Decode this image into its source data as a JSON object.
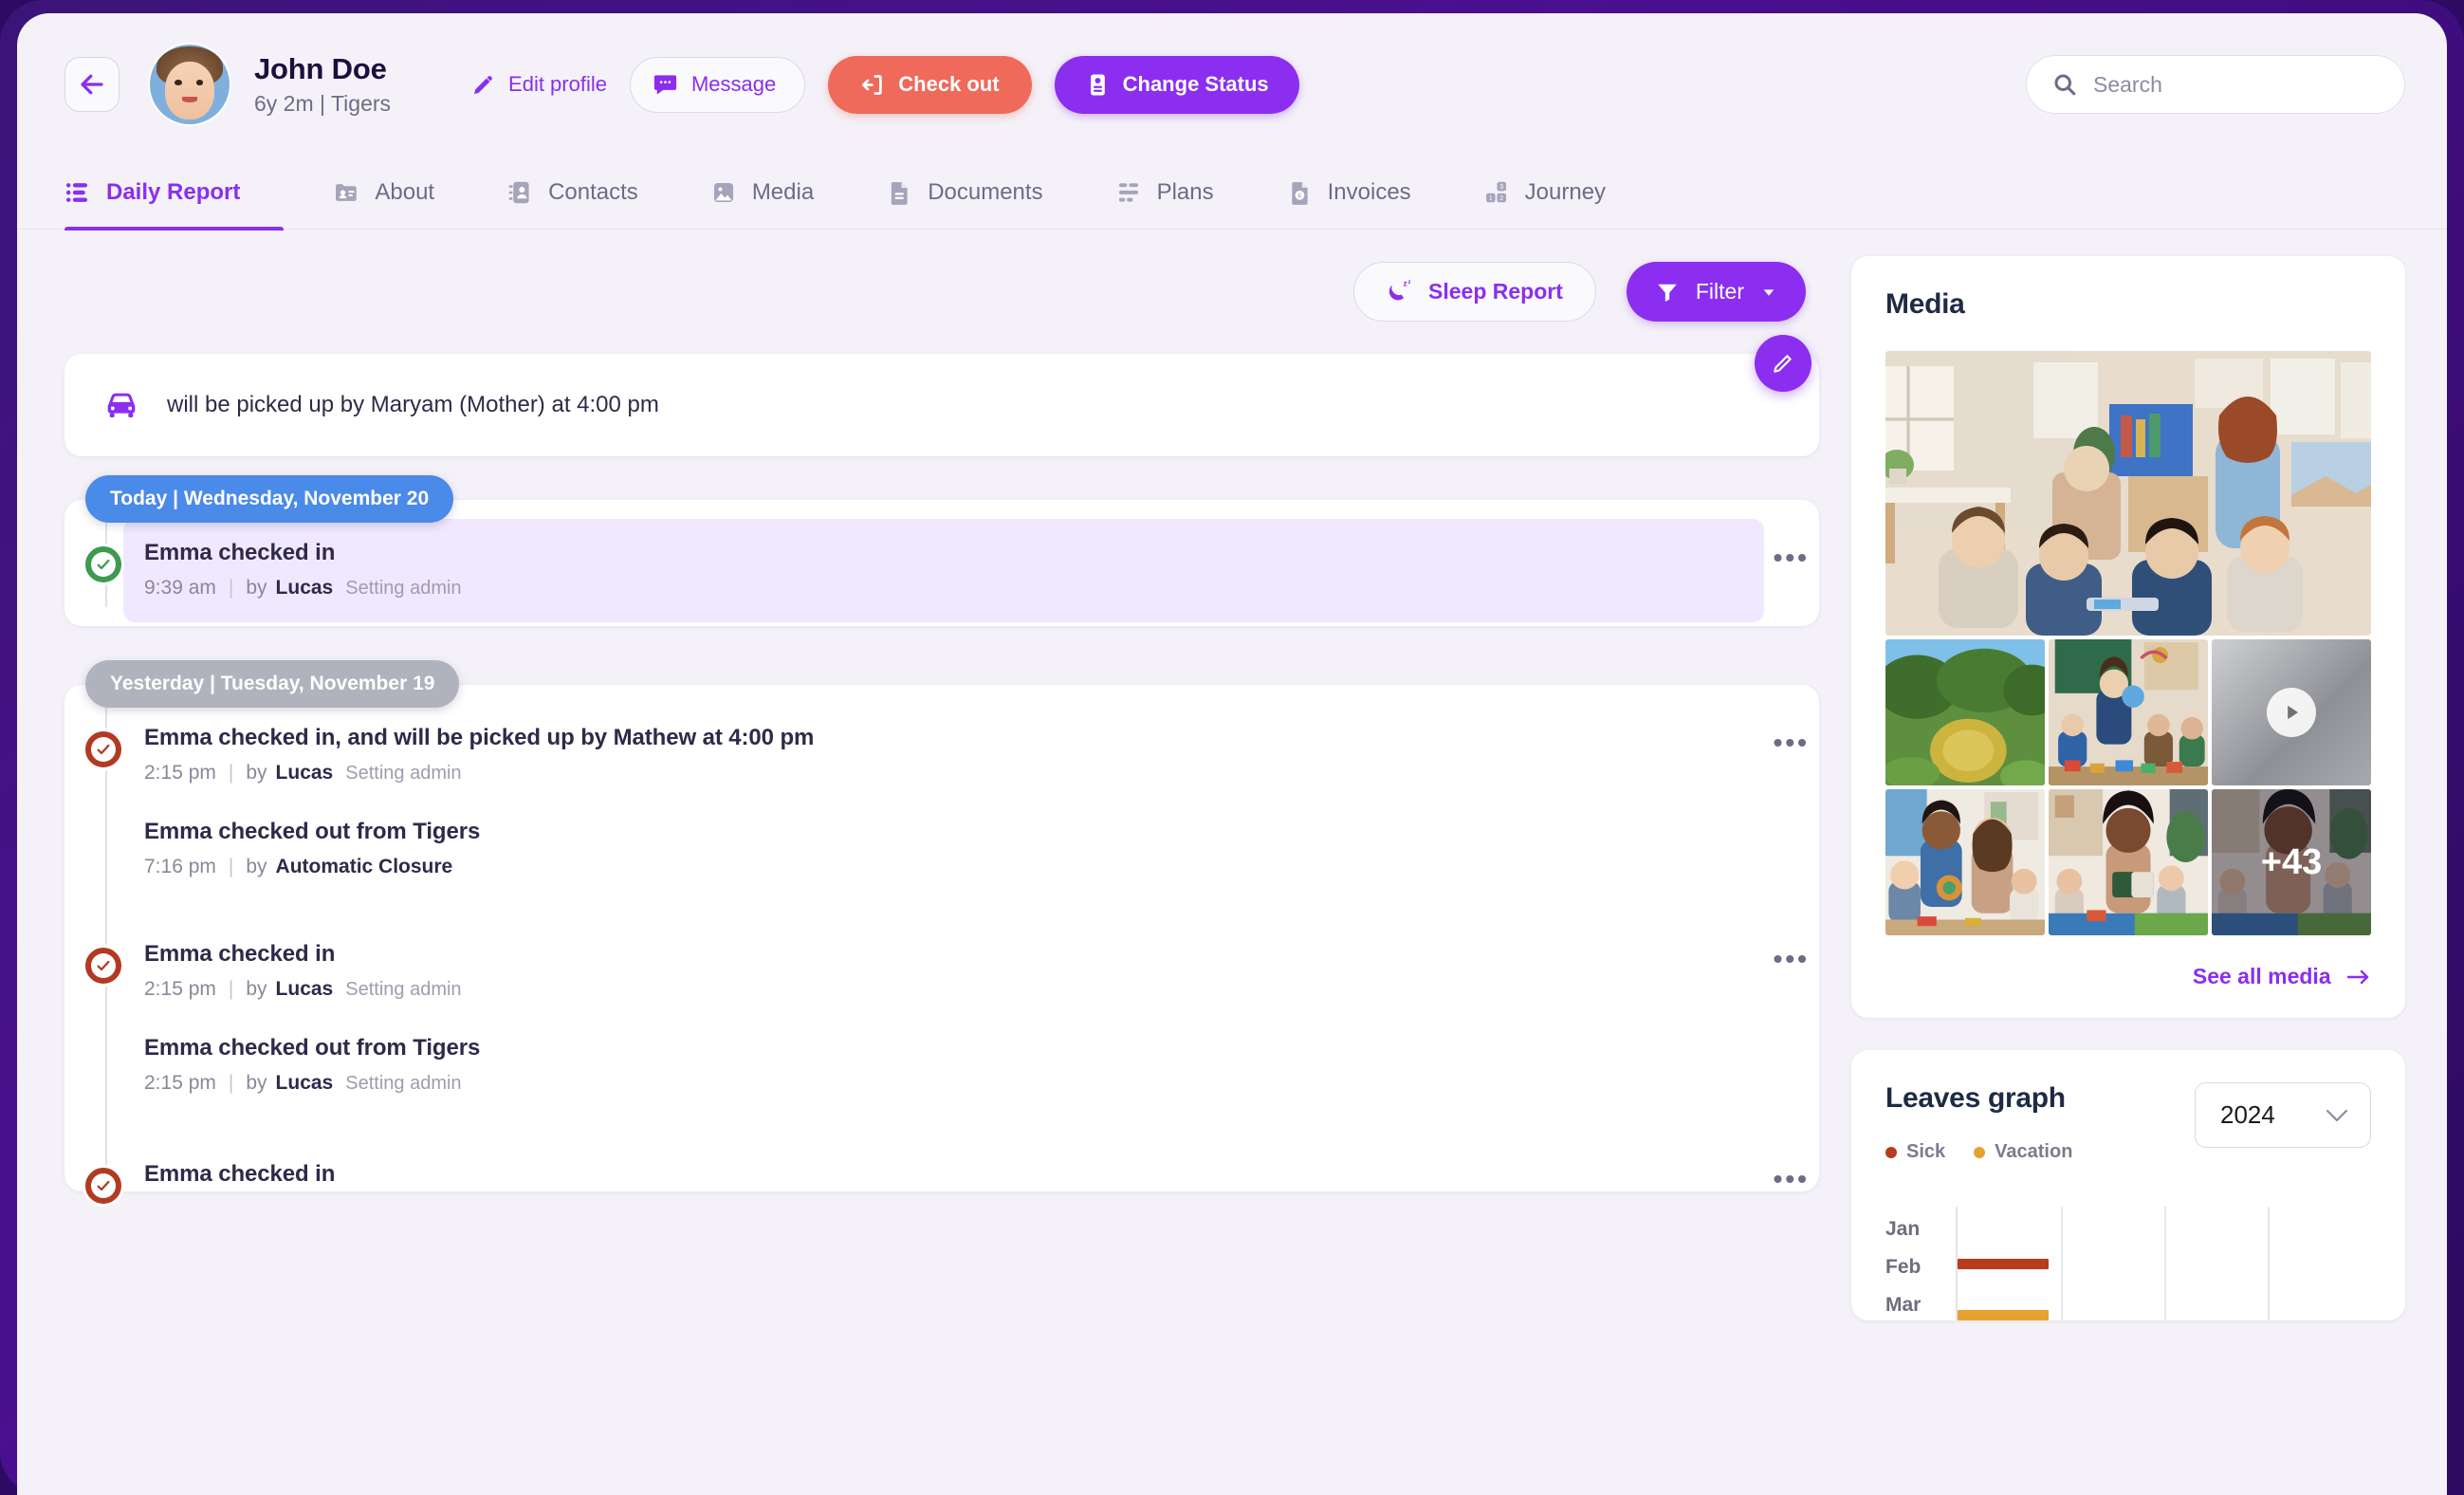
{
  "header": {
    "back_icon": "arrow-left-icon",
    "avatar": "child-photo-avatar",
    "name": "John Doe",
    "subtitle": "6y 2m | Tigers",
    "actions": {
      "edit_profile": "Edit profile",
      "message": "Message",
      "check_out": "Check out",
      "change_status": "Change Status"
    },
    "search": {
      "placeholder": "Search",
      "value": "",
      "icon": "search-icon"
    }
  },
  "tabs": [
    {
      "label": "Daily Report",
      "icon": "list-icon",
      "active": true
    },
    {
      "label": "About",
      "icon": "id-card-icon",
      "active": false
    },
    {
      "label": "Contacts",
      "icon": "contacts-icon",
      "active": false
    },
    {
      "label": "Media",
      "icon": "image-icon",
      "active": false
    },
    {
      "label": "Documents",
      "icon": "document-icon",
      "active": false
    },
    {
      "label": "Plans",
      "icon": "plans-icon",
      "active": false
    },
    {
      "label": "Invoices",
      "icon": "invoice-euro-icon",
      "active": false
    },
    {
      "label": "Journey",
      "icon": "journey-blocks-icon",
      "active": false
    }
  ],
  "report": {
    "sleep_report_label": "Sleep Report",
    "sleep_icon": "moon-zzz-icon",
    "filter_label": "Filter",
    "filter_icon": "funnel-icon",
    "filter_caret": "chevron-down-icon",
    "pickup_notice": {
      "icon": "car-icon",
      "text": "will be picked up by Maryam (Mother) at 4:00 pm",
      "edit_icon": "pencil-icon"
    },
    "groups": [
      {
        "chip": "Today | Wednesday, November 20",
        "chip_style": "blue",
        "entries": [
          {
            "dot": "green",
            "highlight": true,
            "kebab": "more-options-icon",
            "events": [
              {
                "title": "Emma checked in",
                "time": "9:39 am",
                "by_label": "by",
                "author": "Lucas",
                "role": "Setting admin"
              }
            ]
          }
        ]
      },
      {
        "chip": "Yesterday | Tuesday, November 19",
        "chip_style": "grey",
        "entries": [
          {
            "dot": "red",
            "highlight": false,
            "kebab": "more-options-icon",
            "events": [
              {
                "title": "Emma checked in, and will be picked up by Mathew at 4:00 pm",
                "time": "2:15 pm",
                "by_label": "by",
                "author": "Lucas",
                "role": "Setting admin"
              },
              {
                "title": "Emma checked out from Tigers",
                "time": "7:16 pm",
                "by_label": "by",
                "author": "Automatic Closure",
                "role": ""
              }
            ]
          },
          {
            "dot": "red",
            "highlight": false,
            "kebab": "more-options-icon",
            "events": [
              {
                "title": "Emma checked in",
                "time": "2:15 pm",
                "by_label": "by",
                "author": "Lucas",
                "role": "Setting admin"
              },
              {
                "title": "Emma checked out from Tigers",
                "time": "2:15 pm",
                "by_label": "by",
                "author": "Lucas",
                "role": "Setting admin"
              }
            ]
          },
          {
            "dot": "red",
            "highlight": false,
            "kebab": "more-options-icon",
            "events": [
              {
                "title": "Emma checked in",
                "time": "",
                "by_label": "",
                "author": "",
                "role": ""
              }
            ]
          }
        ]
      }
    ]
  },
  "media_panel": {
    "title": "Media",
    "hero": "classroom-teacher-with-children",
    "thumbs": [
      {
        "name": "garden-cactus-photo",
        "kind": "image"
      },
      {
        "name": "classroom-playtime-photo",
        "kind": "image"
      },
      {
        "name": "video-thumbnail",
        "kind": "video",
        "play_icon": "play-icon"
      },
      {
        "name": "parents-playing-with-children-photo",
        "kind": "image"
      },
      {
        "name": "storytime-reading-photo",
        "kind": "image"
      },
      {
        "name": "group-circle-photo",
        "kind": "image",
        "overflow_badge": "+43"
      }
    ],
    "see_all_label": "See all media",
    "see_all_icon": "arrow-right-icon"
  },
  "leaves_panel": {
    "title": "Leaves graph",
    "legend": [
      {
        "label": "Sick",
        "color": "#b83c1f"
      },
      {
        "label": "Vacation",
        "color": "#e5a231"
      }
    ],
    "year_value": "2024",
    "year_caret": "chevron-down-icon"
  },
  "chart_data": {
    "type": "bar",
    "title": "Leaves graph",
    "orientation": "horizontal",
    "categories": [
      "Jan",
      "Feb",
      "Mar"
    ],
    "series": [
      {
        "name": "Sick",
        "color": "#b83c1f",
        "values": [
          0,
          1,
          0
        ]
      },
      {
        "name": "Vacation",
        "color": "#e5a231",
        "values": [
          0,
          0,
          1
        ]
      }
    ],
    "xlabel": "",
    "ylabel": "",
    "xlim": [
      0,
      4
    ],
    "gridlines": 4,
    "grid": true,
    "legend_position": "top-left",
    "note": "Only Jan–Mar rows visible; Feb shows a Sick bar of ~1 unit and Mar shows a Vacation bar of ~1 unit."
  },
  "colors": {
    "accent": "#8b2ef0",
    "danger": "#ef6a5a",
    "today_chip": "#4a8ae8",
    "yesterday_chip": "#b0b2bd",
    "check_in_green": "#3d9a4e",
    "check_red": "#b33a22",
    "page_bg": "#f4f2f8",
    "frame": "#3b1478"
  }
}
